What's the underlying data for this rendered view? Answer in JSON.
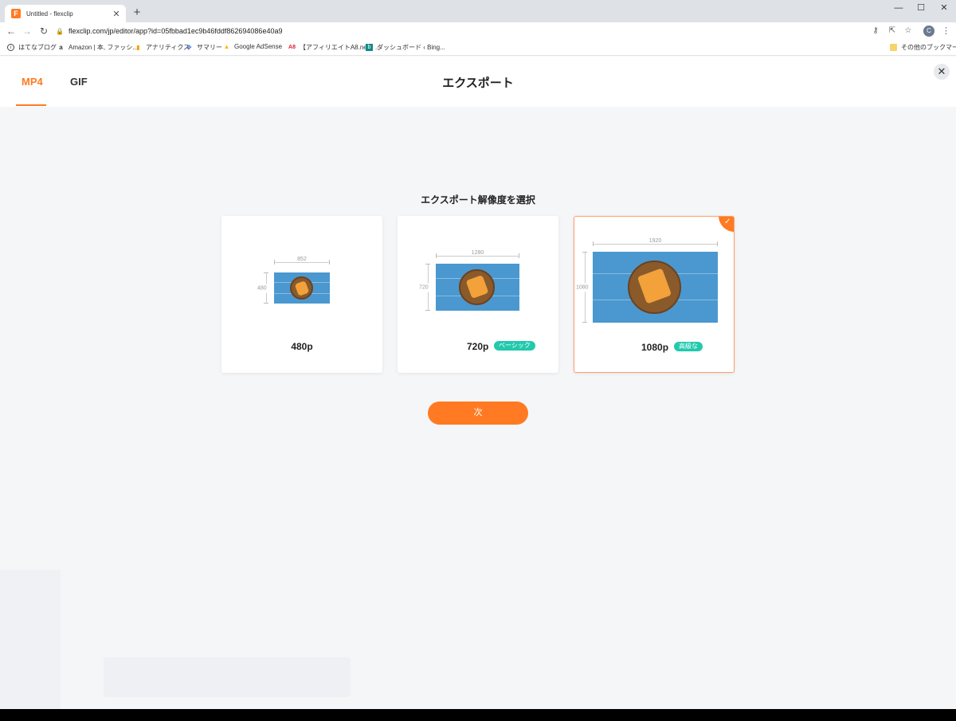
{
  "browser": {
    "tab_title": "Untitled - flexclip",
    "favicon_letter": "F",
    "url": "flexclip.com/jp/editor/app?id=05fbbad1ec9b46fddf862694086e40a9",
    "profile_initial": "C"
  },
  "bookmarks": [
    {
      "label": "はてなブログ",
      "icon": "globe-icon"
    },
    {
      "label": "Amazon | 本, ファッシ...",
      "icon": "amazon-icon"
    },
    {
      "label": "アナリティクス",
      "icon": "analytics-icon"
    },
    {
      "label": "サマリー",
      "icon": "summary-icon"
    },
    {
      "label": "Google AdSense",
      "icon": "adsense-icon"
    },
    {
      "label": "【アフィリエイトA8.net】...",
      "icon": "a8-icon"
    },
    {
      "label": "ダッシュボード ‹ Bing...",
      "icon": "bing-icon"
    }
  ],
  "other_bookmarks": "その他のブックマーク",
  "header": {
    "tabs": [
      {
        "label": "MP4",
        "active": true
      },
      {
        "label": "GIF",
        "active": false
      }
    ],
    "title": "エクスポート",
    "close_icon": "close-icon"
  },
  "main": {
    "section_title": "エクスポート解像度を選択",
    "options": [
      {
        "resolution": "480p",
        "width_label": "852",
        "height_label": "480",
        "badge": "",
        "selected": false
      },
      {
        "resolution": "720p",
        "width_label": "1280",
        "height_label": "720",
        "badge": "ベーシック",
        "selected": false
      },
      {
        "resolution": "1080p",
        "width_label": "1920",
        "height_label": "1080",
        "badge": "高級な",
        "selected": true
      }
    ],
    "next_button": "次"
  },
  "colors": {
    "accent": "#ff7a22",
    "badge": "#23c9ad"
  }
}
